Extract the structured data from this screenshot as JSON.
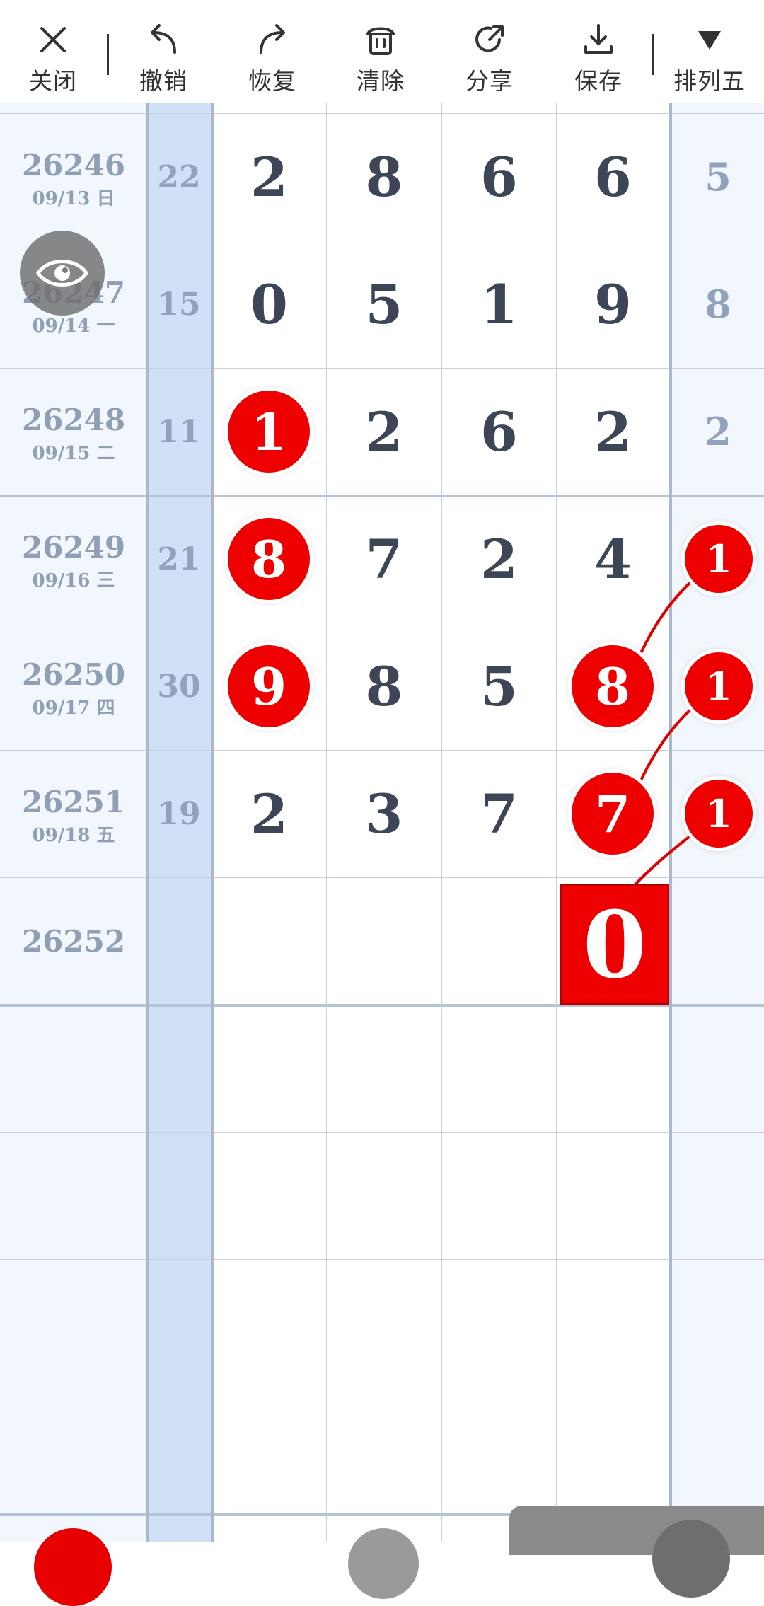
{
  "toolbar": {
    "items": [
      {
        "label": "关闭",
        "icon": "close-icon"
      },
      {
        "label": "撤销",
        "icon": "undo-icon"
      },
      {
        "label": "恢复",
        "icon": "redo-icon"
      },
      {
        "label": "清除",
        "icon": "trash-icon"
      },
      {
        "label": "分享",
        "icon": "share-icon"
      },
      {
        "label": "保存",
        "icon": "download-icon"
      },
      {
        "label": "排列五",
        "icon": "triangle-down-icon"
      }
    ]
  },
  "rows": [
    {
      "issue": "26246",
      "date": "09/13 日",
      "sum": "22",
      "digits": [
        "2",
        "8",
        "6",
        "6"
      ],
      "fifth": "5"
    },
    {
      "issue": "26247",
      "date": "09/14 一",
      "sum": "15",
      "digits": [
        "0",
        "5",
        "1",
        "9"
      ],
      "fifth": "8"
    },
    {
      "issue": "26248",
      "date": "09/15 二",
      "sum": "11",
      "digits": [
        "1",
        "2",
        "6",
        "2"
      ],
      "fifth": "2"
    },
    {
      "issue": "26249",
      "date": "09/16 三",
      "sum": "21",
      "digits": [
        "8",
        "7",
        "2",
        "4"
      ],
      "fifth": "1"
    },
    {
      "issue": "26250",
      "date": "09/17 四",
      "sum": "30",
      "digits": [
        "9",
        "8",
        "5",
        "8"
      ],
      "fifth": "1"
    },
    {
      "issue": "26251",
      "date": "09/18 五",
      "sum": "19",
      "digits": [
        "2",
        "3",
        "7",
        "7"
      ],
      "fifth": "1"
    },
    {
      "issue": "26252",
      "date": "",
      "sum": "",
      "digits": [
        "",
        "",
        "",
        "0"
      ],
      "fifth": ""
    }
  ],
  "colors": {
    "accent_red": "#ee0000",
    "sum_column": "#cfe0f7",
    "side_column": "#f2f6fd"
  }
}
